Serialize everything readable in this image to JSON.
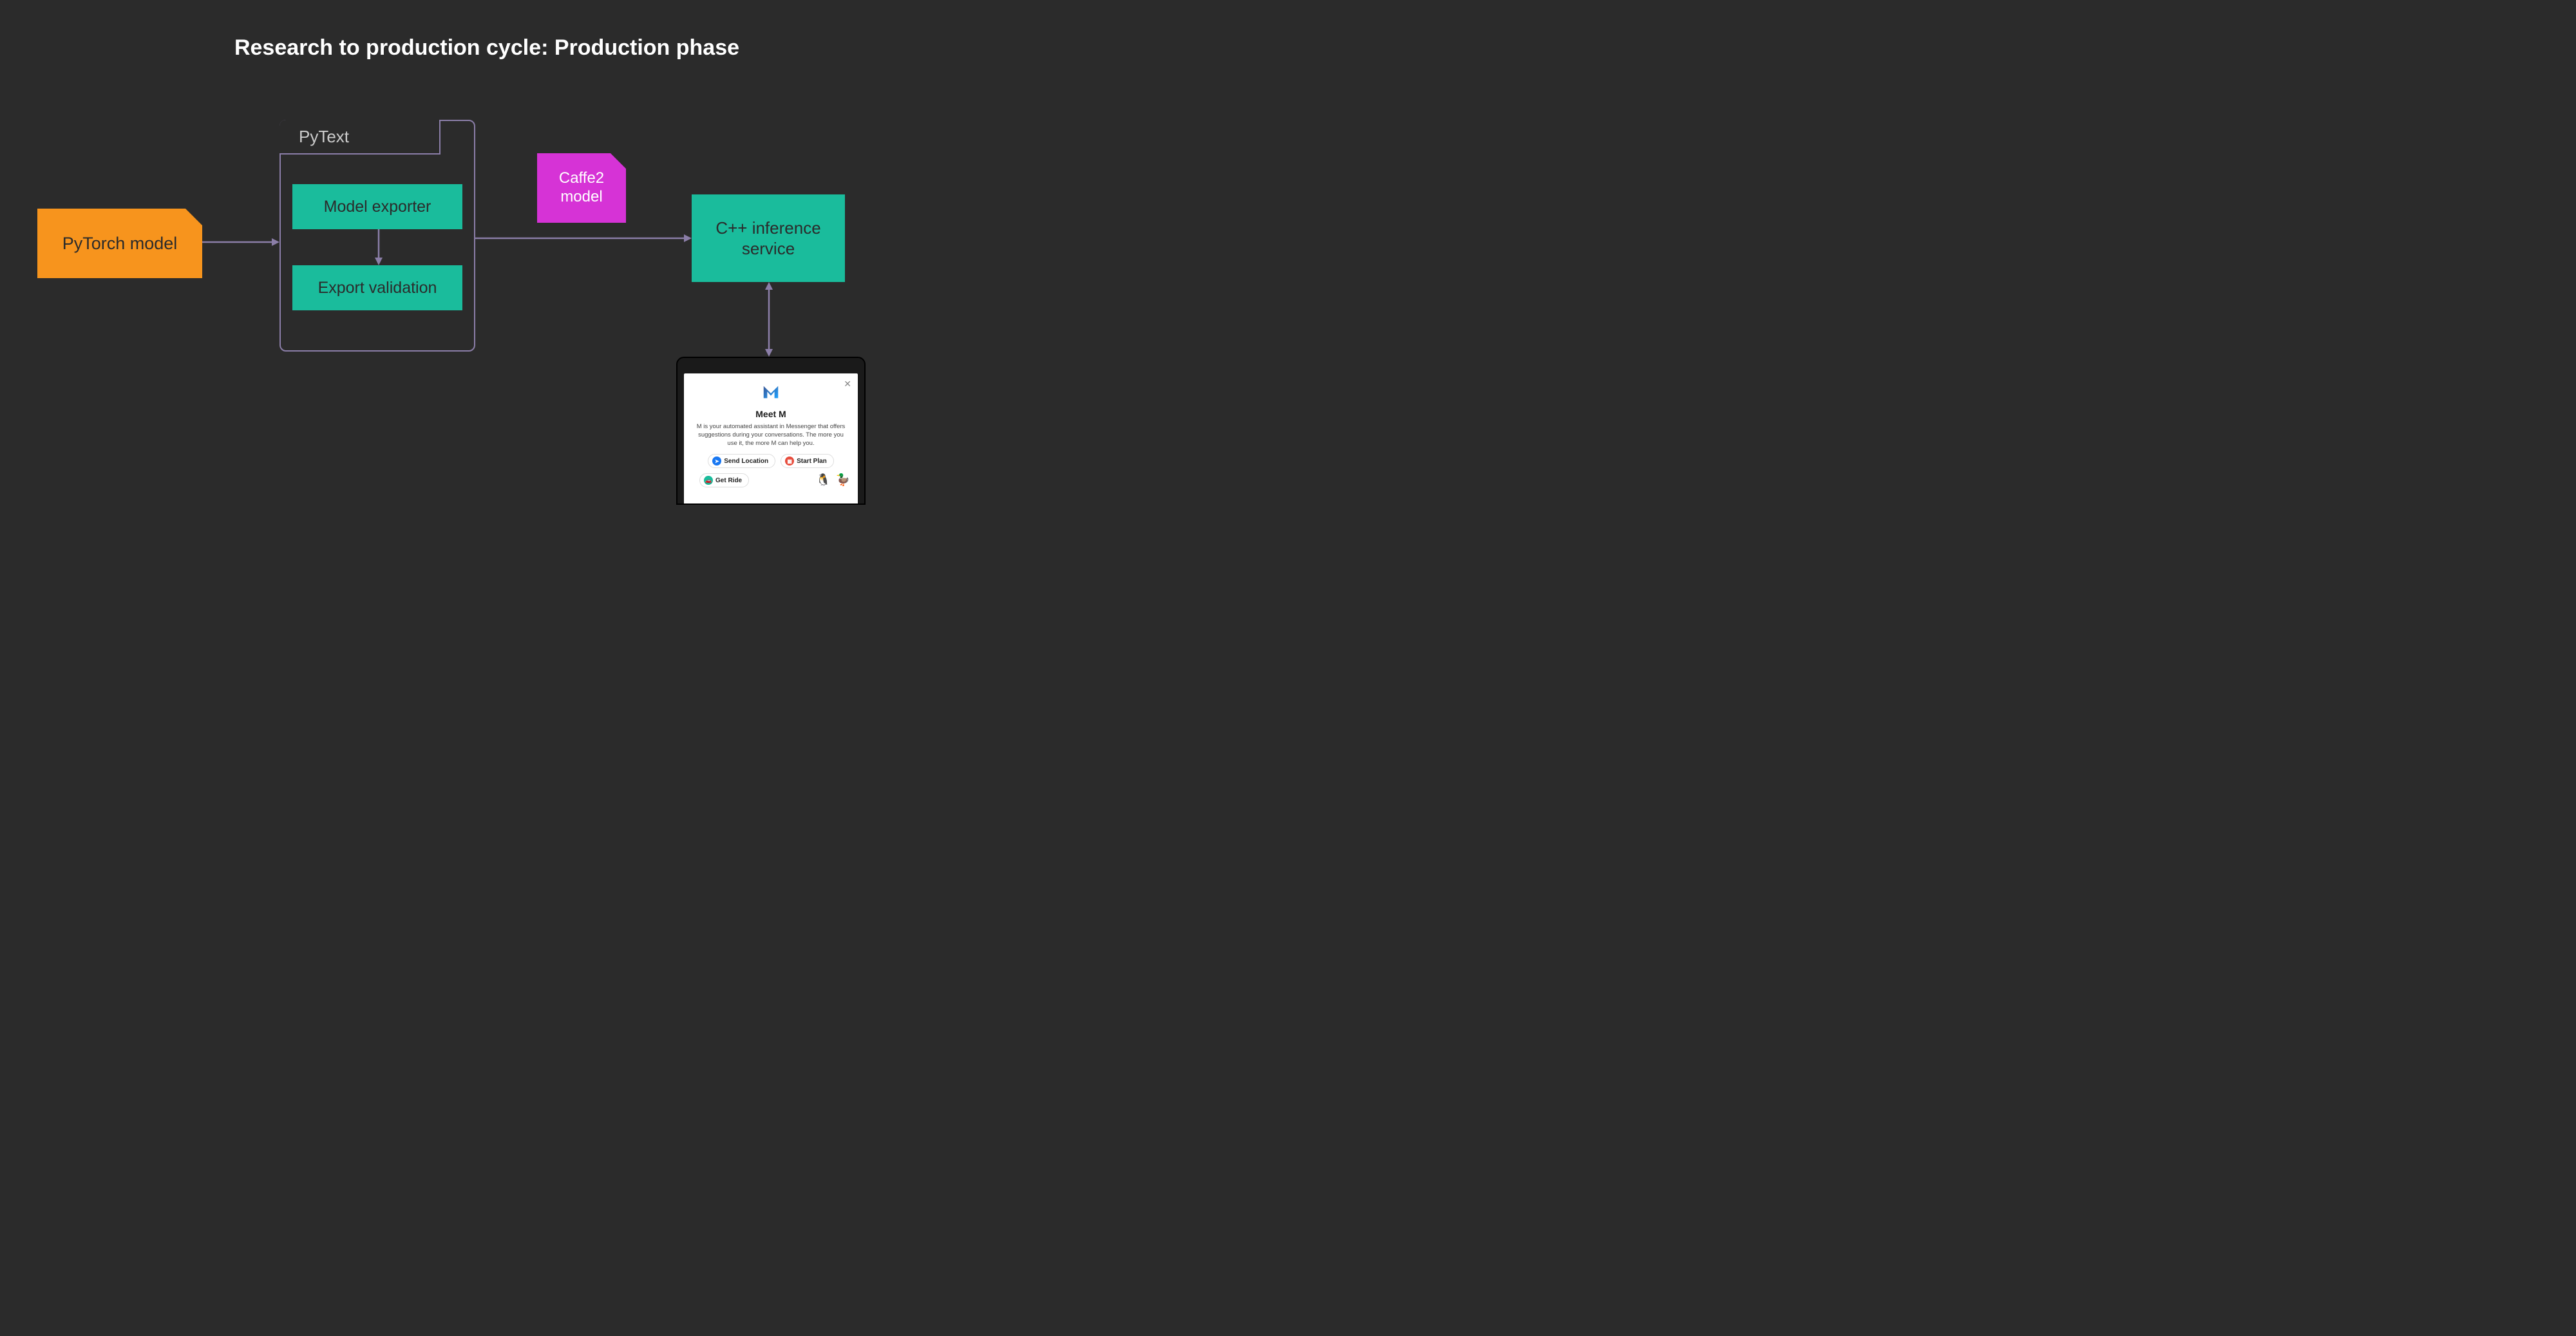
{
  "title": "Research to production cycle: Production phase",
  "nodes": {
    "pytorch": "PyTorch model",
    "pytext_label": "PyText",
    "model_exporter": "Model exporter",
    "export_validation": "Export validation",
    "caffe2": "Caffe2\nmodel",
    "cpp_service": "C++ inference\nservice"
  },
  "phone": {
    "title": "Meet M",
    "description": "M is your automated assistant in Messenger that offers suggestions during your conversations. The more you use it, the more M can help you.",
    "chips": {
      "send_location": "Send Location",
      "start_plan": "Start Plan",
      "get_ride": "Get Ride"
    }
  }
}
